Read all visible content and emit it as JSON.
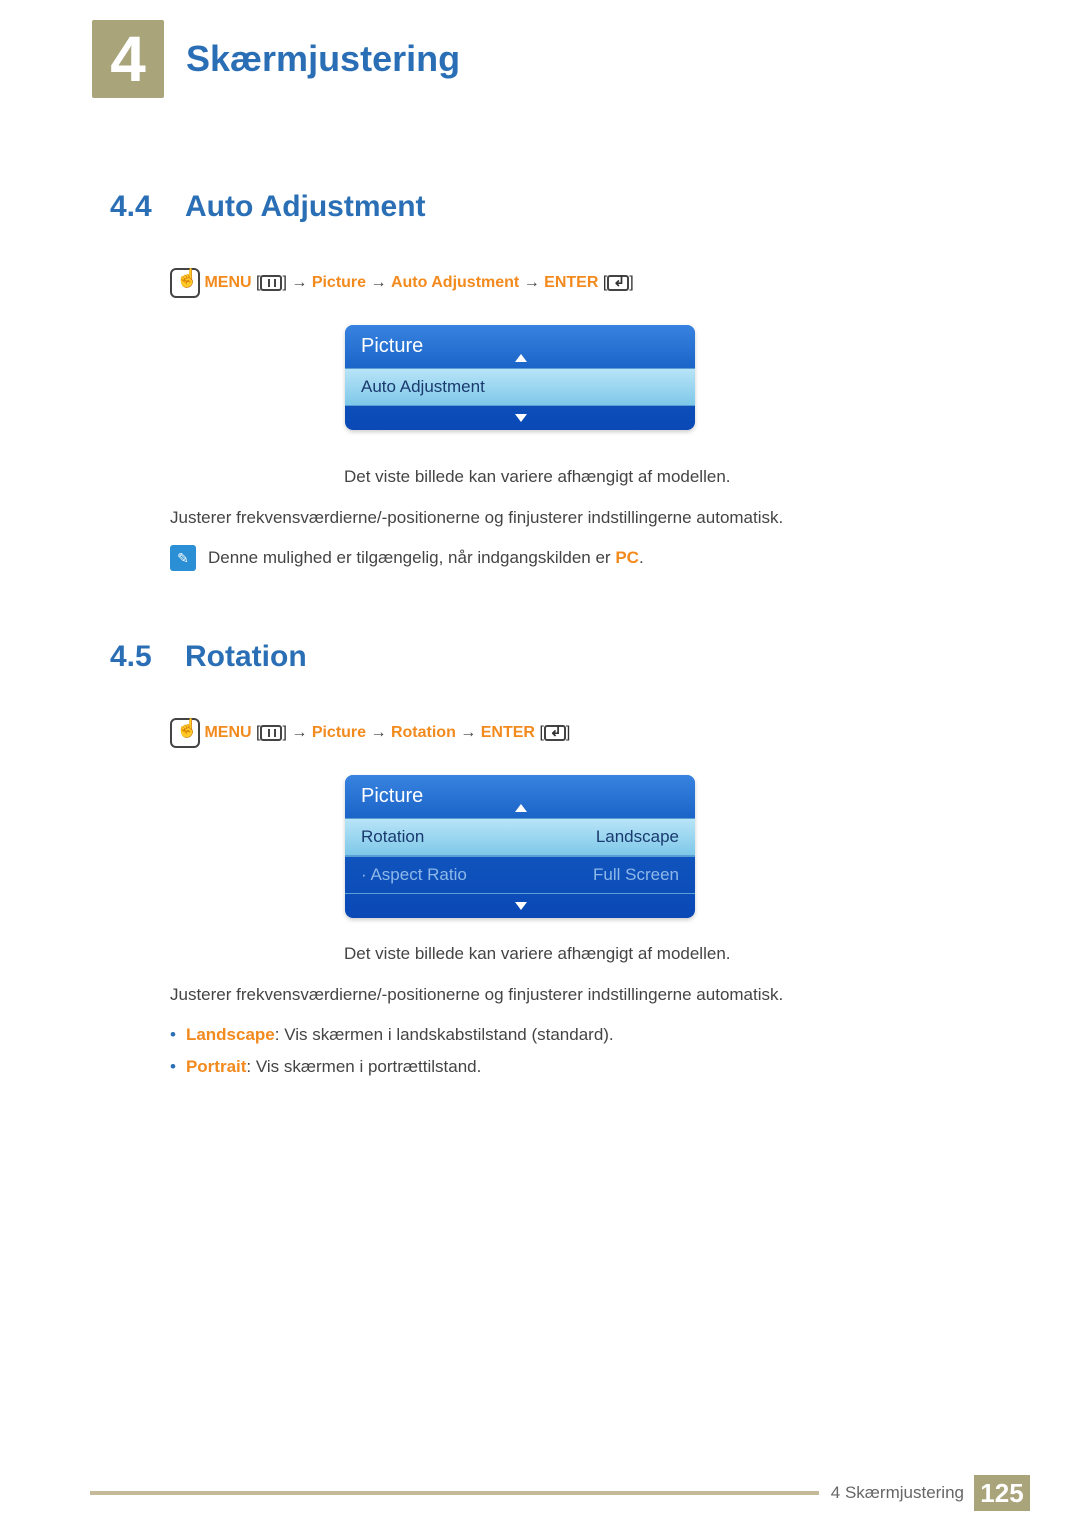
{
  "chapter": {
    "number": "4",
    "title": "Skærmjustering"
  },
  "sec44": {
    "num": "4.4",
    "title": "Auto Adjustment",
    "path": {
      "menu": "MENU",
      "p2": "Picture",
      "p3": "Auto Adjustment",
      "enter": "ENTER"
    },
    "osd": {
      "header": "Picture",
      "item": "Auto Adjustment"
    },
    "caption": "Det viste billede kan variere afhængigt af modellen.",
    "body": "Justerer frekvensværdierne/-positionerne og finjusterer indstillingerne automatisk.",
    "note_prefix": "Denne mulighed er tilgængelig, når indgangskilden er ",
    "note_pc": "PC",
    "note_suffix": "."
  },
  "sec45": {
    "num": "4.5",
    "title": "Rotation",
    "path": {
      "menu": "MENU",
      "p2": "Picture",
      "p3": "Rotation",
      "enter": "ENTER"
    },
    "osd": {
      "header": "Picture",
      "r1": {
        "label": "Rotation",
        "value": "Landscape"
      },
      "r2": {
        "label": "Aspect Ratio",
        "value": "Full Screen"
      }
    },
    "caption": "Det viste billede kan variere afhængigt af modellen.",
    "body": "Justerer frekvensværdierne/-positionerne og finjusterer indstillingerne automatisk.",
    "b1": {
      "label": "Landscape",
      "text": ": Vis skærmen i landskabstilstand (standard)."
    },
    "b2": {
      "label": "Portrait",
      "text": ": Vis skærmen i portrættilstand."
    }
  },
  "footer": {
    "chapter": "4 Skærmjustering",
    "page": "125"
  }
}
